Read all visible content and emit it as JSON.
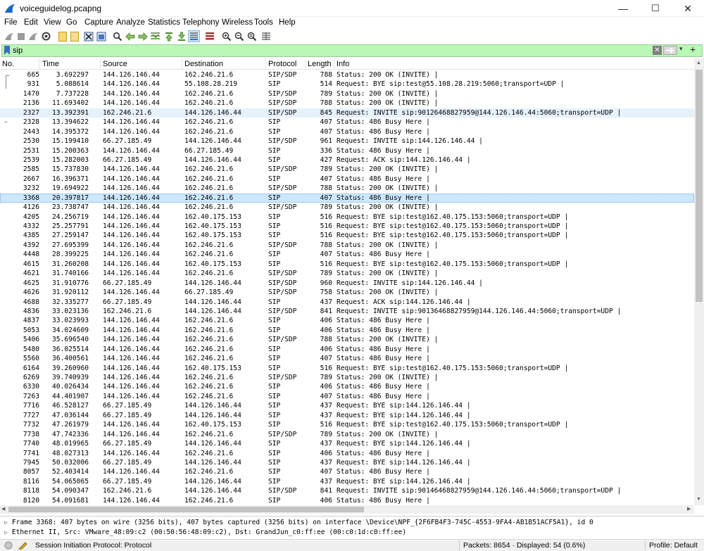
{
  "window": {
    "title": "voiceguidelog.pcapng",
    "minimize": "—",
    "maximize": "☐",
    "close": "✕"
  },
  "menu": [
    {
      "label": "File",
      "key": "F",
      "rest": "ile"
    },
    {
      "label": "Edit",
      "key": "E",
      "rest": "dit"
    },
    {
      "label": "View",
      "key": "V",
      "rest": "iew"
    },
    {
      "label": "Go",
      "key": "G",
      "rest": "o"
    },
    {
      "label": "Capture",
      "key": "C",
      "rest": "apture"
    },
    {
      "label": "Analyze",
      "key": "A",
      "rest": "nalyze"
    },
    {
      "label": "Statistics",
      "key": "S",
      "rest": "tatistics"
    },
    {
      "label": "Telephony",
      "key": "y",
      "pre": "Teleph",
      "post": "",
      "rest": ""
    },
    {
      "label": "Wireless",
      "key": "W",
      "rest": "ireless"
    },
    {
      "label": "Tools",
      "key": "T",
      "rest": "ools"
    },
    {
      "label": "Help",
      "key": "H",
      "rest": "elp"
    }
  ],
  "toolbar": [
    "shark-fin-start-icon",
    "stop-capture-icon",
    "restart-capture-icon",
    "capture-options-icon",
    "open-file-icon",
    "save-file-icon",
    "close-file-icon",
    "reload-file-icon",
    "find-packet-icon",
    "go-back-icon",
    "go-forward-icon",
    "go-to-packet-icon",
    "go-first-icon",
    "go-last-icon",
    "autoscroll-icon",
    "colorize-icon",
    "zoom-in-icon",
    "zoom-out-icon",
    "zoom-normal-icon",
    "resize-columns-icon"
  ],
  "filter": {
    "value": "sip",
    "apply_symbol": "→",
    "dropdown_symbol": "▾",
    "add_symbol": "+",
    "clear_symbol": "✕"
  },
  "columns": [
    "No.",
    "Time",
    "Source",
    "Destination",
    "Protocol",
    "Length",
    "Info"
  ],
  "packets": [
    {
      "no": "665",
      "time": "3.692297",
      "src": "144.126.146.44",
      "dst": "162.246.21.6",
      "proto": "SIP/SDP",
      "len": "788",
      "info": "Status: 200 OK (INVITE) |"
    },
    {
      "no": "931",
      "time": "5.088614",
      "src": "144.126.146.44",
      "dst": "55.108.28.219",
      "proto": "SIP",
      "len": "514",
      "info": "Request: BYE sip:test@55.108.28.219:5060;transport=UDP |"
    },
    {
      "no": "1470",
      "time": "7.737228",
      "src": "144.126.146.44",
      "dst": "162.246.21.6",
      "proto": "SIP/SDP",
      "len": "789",
      "info": "Status: 200 OK (INVITE) |"
    },
    {
      "no": "2136",
      "time": "11.693402",
      "src": "144.126.146.44",
      "dst": "162.246.21.6",
      "proto": "SIP/SDP",
      "len": "788",
      "info": "Status: 200 OK (INVITE) |"
    },
    {
      "no": "2327",
      "time": "13.392391",
      "src": "162.246.21.6",
      "dst": "144.126.146.44",
      "proto": "SIP/SDP",
      "len": "845",
      "info": "Request: INVITE sip:90126468827959@144.126.146.44:5060;transport=UDP |"
    },
    {
      "no": "2328",
      "time": "13.394622",
      "src": "144.126.146.44",
      "dst": "162.246.21.6",
      "proto": "SIP",
      "len": "407",
      "info": "Status: 486 Busy Here |"
    },
    {
      "no": "2443",
      "time": "14.395372",
      "src": "144.126.146.44",
      "dst": "162.246.21.6",
      "proto": "SIP",
      "len": "407",
      "info": "Status: 486 Busy Here |"
    },
    {
      "no": "2530",
      "time": "15.199410",
      "src": "66.27.185.49",
      "dst": "144.126.146.44",
      "proto": "SIP/SDP",
      "len": "961",
      "info": "Request: INVITE sip:144.126.146.44 |"
    },
    {
      "no": "2531",
      "time": "15.200363",
      "src": "144.126.146.44",
      "dst": "66.27.185.49",
      "proto": "SIP",
      "len": "336",
      "info": "Status: 486 Busy Here |"
    },
    {
      "no": "2539",
      "time": "15.282003",
      "src": "66.27.185.49",
      "dst": "144.126.146.44",
      "proto": "SIP",
      "len": "427",
      "info": "Request: ACK sip:144.126.146.44 |"
    },
    {
      "no": "2585",
      "time": "15.737830",
      "src": "144.126.146.44",
      "dst": "162.246.21.6",
      "proto": "SIP/SDP",
      "len": "789",
      "info": "Status: 200 OK (INVITE) |"
    },
    {
      "no": "2667",
      "time": "16.396371",
      "src": "144.126.146.44",
      "dst": "162.246.21.6",
      "proto": "SIP",
      "len": "407",
      "info": "Status: 486 Busy Here |"
    },
    {
      "no": "3232",
      "time": "19.694922",
      "src": "144.126.146.44",
      "dst": "162.246.21.6",
      "proto": "SIP/SDP",
      "len": "788",
      "info": "Status: 200 OK (INVITE) |"
    },
    {
      "no": "3368",
      "time": "20.397817",
      "src": "144.126.146.44",
      "dst": "162.246.21.6",
      "proto": "SIP",
      "len": "407",
      "info": "Status: 486 Busy Here |"
    },
    {
      "no": "4126",
      "time": "23.738747",
      "src": "144.126.146.44",
      "dst": "162.246.21.6",
      "proto": "SIP/SDP",
      "len": "789",
      "info": "Status: 200 OK (INVITE) |"
    },
    {
      "no": "4205",
      "time": "24.256719",
      "src": "144.126.146.44",
      "dst": "162.40.175.153",
      "proto": "SIP",
      "len": "516",
      "info": "Request: BYE sip:test@162.40.175.153:5060;transport=UDP |"
    },
    {
      "no": "4332",
      "time": "25.257791",
      "src": "144.126.146.44",
      "dst": "162.40.175.153",
      "proto": "SIP",
      "len": "516",
      "info": "Request: BYE sip:test@162.40.175.153:5060;transport=UDP |"
    },
    {
      "no": "4385",
      "time": "27.259147",
      "src": "144.126.146.44",
      "dst": "162.40.175.153",
      "proto": "SIP",
      "len": "516",
      "info": "Request: BYE sip:test@162.40.175.153:5060;transport=UDP |"
    },
    {
      "no": "4392",
      "time": "27.695399",
      "src": "144.126.146.44",
      "dst": "162.246.21.6",
      "proto": "SIP/SDP",
      "len": "788",
      "info": "Status: 200 OK (INVITE) |"
    },
    {
      "no": "4448",
      "time": "28.399225",
      "src": "144.126.146.44",
      "dst": "162.246.21.6",
      "proto": "SIP",
      "len": "407",
      "info": "Status: 486 Busy Here |"
    },
    {
      "no": "4615",
      "time": "31.260208",
      "src": "144.126.146.44",
      "dst": "162.40.175.153",
      "proto": "SIP",
      "len": "516",
      "info": "Request: BYE sip:test@162.40.175.153:5060;transport=UDP |"
    },
    {
      "no": "4621",
      "time": "31.740166",
      "src": "144.126.146.44",
      "dst": "162.246.21.6",
      "proto": "SIP/SDP",
      "len": "789",
      "info": "Status: 200 OK (INVITE) |"
    },
    {
      "no": "4625",
      "time": "31.910776",
      "src": "66.27.185.49",
      "dst": "144.126.146.44",
      "proto": "SIP/SDP",
      "len": "960",
      "info": "Request: INVITE sip:144.126.146.44 |"
    },
    {
      "no": "4626",
      "time": "31.920112",
      "src": "144.126.146.44",
      "dst": "66.27.185.49",
      "proto": "SIP/SDP",
      "len": "758",
      "info": "Status: 200 OK (INVITE) |"
    },
    {
      "no": "4688",
      "time": "32.335277",
      "src": "66.27.185.49",
      "dst": "144.126.146.44",
      "proto": "SIP",
      "len": "437",
      "info": "Request: ACK sip:144.126.146.44 |"
    },
    {
      "no": "4836",
      "time": "33.023136",
      "src": "162.246.21.6",
      "dst": "144.126.146.44",
      "proto": "SIP/SDP",
      "len": "841",
      "info": "Request: INVITE sip:90136468827959@144.126.146.44:5060;transport=UDP |"
    },
    {
      "no": "4837",
      "time": "33.023993",
      "src": "144.126.146.44",
      "dst": "162.246.21.6",
      "proto": "SIP",
      "len": "406",
      "info": "Status: 486 Busy Here |"
    },
    {
      "no": "5053",
      "time": "34.024609",
      "src": "144.126.146.44",
      "dst": "162.246.21.6",
      "proto": "SIP",
      "len": "406",
      "info": "Status: 486 Busy Here |"
    },
    {
      "no": "5406",
      "time": "35.696540",
      "src": "144.126.146.44",
      "dst": "162.246.21.6",
      "proto": "SIP/SDP",
      "len": "788",
      "info": "Status: 200 OK (INVITE) |"
    },
    {
      "no": "5480",
      "time": "36.025514",
      "src": "144.126.146.44",
      "dst": "162.246.21.6",
      "proto": "SIP",
      "len": "406",
      "info": "Status: 486 Busy Here |"
    },
    {
      "no": "5560",
      "time": "36.400561",
      "src": "144.126.146.44",
      "dst": "162.246.21.6",
      "proto": "SIP",
      "len": "407",
      "info": "Status: 486 Busy Here |"
    },
    {
      "no": "6164",
      "time": "39.260960",
      "src": "144.126.146.44",
      "dst": "162.40.175.153",
      "proto": "SIP",
      "len": "516",
      "info": "Request: BYE sip:test@162.40.175.153:5060;transport=UDP |"
    },
    {
      "no": "6269",
      "time": "39.740939",
      "src": "144.126.146.44",
      "dst": "162.246.21.6",
      "proto": "SIP/SDP",
      "len": "789",
      "info": "Status: 200 OK (INVITE) |"
    },
    {
      "no": "6330",
      "time": "40.026434",
      "src": "144.126.146.44",
      "dst": "162.246.21.6",
      "proto": "SIP",
      "len": "406",
      "info": "Status: 486 Busy Here |"
    },
    {
      "no": "7263",
      "time": "44.401907",
      "src": "144.126.146.44",
      "dst": "162.246.21.6",
      "proto": "SIP",
      "len": "407",
      "info": "Status: 486 Busy Here |"
    },
    {
      "no": "7716",
      "time": "46.528127",
      "src": "66.27.185.49",
      "dst": "144.126.146.44",
      "proto": "SIP",
      "len": "437",
      "info": "Request: BYE sip:144.126.146.44 |"
    },
    {
      "no": "7727",
      "time": "47.036144",
      "src": "66.27.185.49",
      "dst": "144.126.146.44",
      "proto": "SIP",
      "len": "437",
      "info": "Request: BYE sip:144.126.146.44 |"
    },
    {
      "no": "7732",
      "time": "47.261979",
      "src": "144.126.146.44",
      "dst": "162.40.175.153",
      "proto": "SIP",
      "len": "516",
      "info": "Request: BYE sip:test@162.40.175.153:5060;transport=UDP |"
    },
    {
      "no": "7738",
      "time": "47.742336",
      "src": "144.126.146.44",
      "dst": "162.246.21.6",
      "proto": "SIP/SDP",
      "len": "789",
      "info": "Status: 200 OK (INVITE) |"
    },
    {
      "no": "7740",
      "time": "48.019965",
      "src": "66.27.185.49",
      "dst": "144.126.146.44",
      "proto": "SIP",
      "len": "437",
      "info": "Request: BYE sip:144.126.146.44 |"
    },
    {
      "no": "7741",
      "time": "48.027313",
      "src": "144.126.146.44",
      "dst": "162.246.21.6",
      "proto": "SIP",
      "len": "406",
      "info": "Status: 486 Busy Here |"
    },
    {
      "no": "7945",
      "time": "50.032006",
      "src": "66.27.185.49",
      "dst": "144.126.146.44",
      "proto": "SIP",
      "len": "437",
      "info": "Request: BYE sip:144.126.146.44 |"
    },
    {
      "no": "8057",
      "time": "52.403414",
      "src": "144.126.146.44",
      "dst": "162.246.21.6",
      "proto": "SIP",
      "len": "407",
      "info": "Status: 486 Busy Here |"
    },
    {
      "no": "8116",
      "time": "54.065065",
      "src": "66.27.185.49",
      "dst": "144.126.146.44",
      "proto": "SIP",
      "len": "437",
      "info": "Request: BYE sip:144.126.146.44 |"
    },
    {
      "no": "8118",
      "time": "54.090347",
      "src": "162.246.21.6",
      "dst": "144.126.146.44",
      "proto": "SIP/SDP",
      "len": "841",
      "info": "Request: INVITE sip:90146468827959@144.126.146.44:5060;transport=UDP |"
    },
    {
      "no": "8120",
      "time": "54.091681",
      "src": "144.126.146.44",
      "dst": "162.246.21.6",
      "proto": "SIP",
      "len": "406",
      "info": "Status: 486 Busy Here |"
    }
  ],
  "selected_packet": "3368",
  "highlighted_packet": "2327",
  "details": [
    "Frame 3368: 407 bytes on wire (3256 bits), 407 bytes captured (3256 bits) on interface \\Device\\NPF_{2F6FB4F3-745C-4553-9FA4-AB1B51ACF5A1}, id 0",
    "Ethernet II, Src: VMware_48:09:c2 (00:50:56:48:09:c2), Dst: GrandJun_c0:ff:ee (00:c0:1d:c0:ff:ee)"
  ],
  "status": {
    "protocol": "Session Initiation Protocol: Protocol",
    "packets": "Packets: 8654 · Displayed: 54 (0.6%)",
    "profile": "Profile: Default"
  },
  "colors": {
    "filter_bg": "#b9f8b5",
    "selected_row": "#cce8ff",
    "highlight_row": "#e6f1fb"
  }
}
